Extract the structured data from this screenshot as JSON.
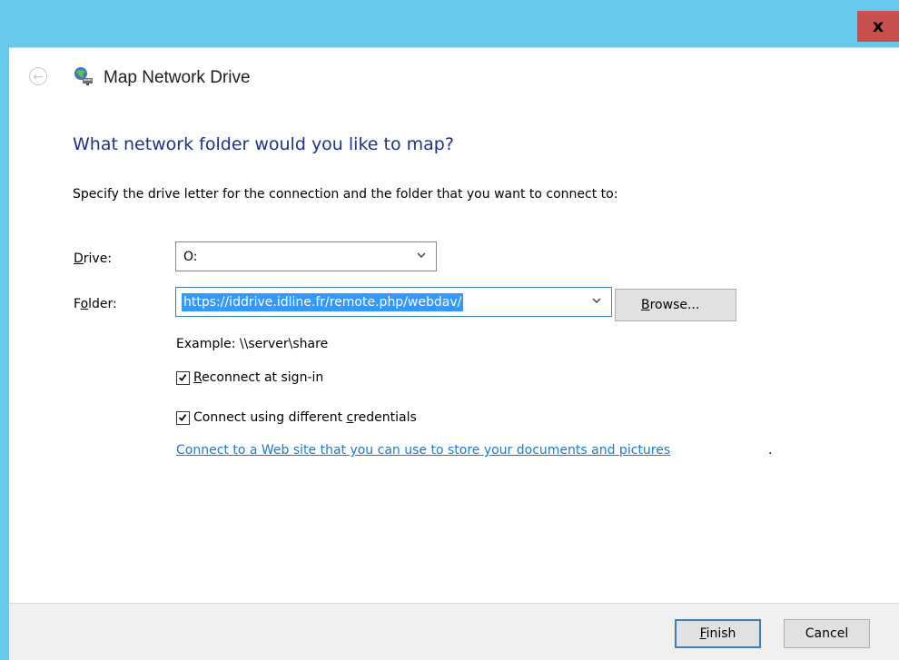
{
  "window": {
    "close_label": "x",
    "back_icon": "back-arrow-icon",
    "app_icon": "network-drive-icon",
    "title": "Map Network Drive"
  },
  "main": {
    "heading": "What network folder would you like to map?",
    "description": "Specify the drive letter for the connection and the folder that you want to connect to:",
    "drive": {
      "label_accel": "D",
      "label_rest": "rive:",
      "value": "O:"
    },
    "folder": {
      "label_pre": "F",
      "label_accel": "o",
      "label_rest": "lder:",
      "value": "https://iddrive.idline.fr/remote.php/webdav/"
    },
    "browse": {
      "accel": "B",
      "rest": "rowse..."
    },
    "example": "Example: \\\\server\\share",
    "reconnect": {
      "accel": "R",
      "rest": "econnect at sign-in",
      "checked": true
    },
    "credentials": {
      "pre": "Connect using different ",
      "accel": "c",
      "rest": "redentials",
      "checked": true
    },
    "web_link": "Connect to a Web site that you can use to store your documents and pictures",
    "web_link_suffix": "."
  },
  "footer": {
    "finish": {
      "accel": "F",
      "rest": "inish"
    },
    "cancel": "Cancel"
  },
  "colors": {
    "titlebar": "#66c8ea",
    "close": "#c7504f",
    "heading": "#1e3287",
    "link": "#1a7bd0",
    "selection": "#3399ff"
  }
}
